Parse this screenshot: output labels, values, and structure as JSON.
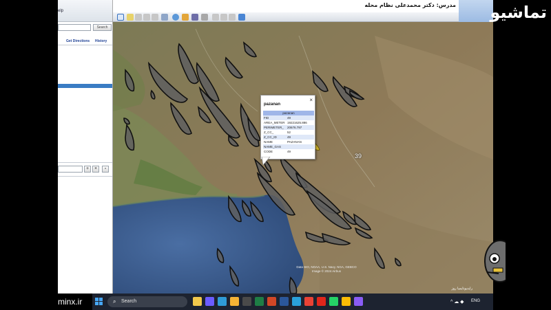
{
  "app": {
    "menu_help": "elp",
    "search": {
      "placeholder": "",
      "button_label": "Search"
    },
    "tabs": {
      "directions": "Get Directions",
      "history": "History"
    },
    "list_controls": {
      "add": "+",
      "remove": "×"
    }
  },
  "header": {
    "instructor": "مدرس: دکتر محمدعلی نظام محله",
    "logo_text": "تماشیو"
  },
  "popup": {
    "title": "pazanan",
    "close": "×",
    "table_header": "pazanan",
    "rows": [
      {
        "key": "FID",
        "value": "49"
      },
      {
        "key": "AREA_METER",
        "value": "19221625.886"
      },
      {
        "key": "PERIMETER_",
        "value": "20676.797"
      },
      {
        "key": "Z_CC_",
        "value": "52"
      },
      {
        "key": "Z_CC_ID",
        "value": "49"
      },
      {
        "key": "NAME",
        "value": "PAZANAN"
      },
      {
        "key": "NAME_GAS",
        "value": ""
      },
      {
        "key": "CODE",
        "value": "49"
      }
    ]
  },
  "map": {
    "label_39": "39",
    "attribution_line1": "Data SIO, NOAA, U.S. Navy, NGA, GEBCO",
    "attribution_line2": "Image © 2024 Airbus",
    "status": "ﺭﺍﻳﺪﻳﻮﻧﺎﻳﻤﻴﺎ ﺭﻭﺯ"
  },
  "watermark": {
    "site": "minx.ir"
  },
  "taskbar": {
    "search_label": "Search",
    "language": "ENG",
    "apps": [
      "file-explorer",
      "copilot",
      "edge",
      "folder",
      "calculator",
      "excel",
      "powerpoint",
      "word",
      "telegram",
      "chrome",
      "opera",
      "whatsapp",
      "chrome-alt",
      "media"
    ],
    "app_colors": [
      "#f2c94c",
      "#6b5cff",
      "#2f9bd6",
      "#f5b335",
      "#4a4a4a",
      "#1e7e45",
      "#d24726",
      "#2b579a",
      "#2aa1da",
      "#e94235",
      "#e0261b",
      "#25d366",
      "#fbbc05",
      "#8a5cf5"
    ]
  },
  "colors": {
    "polygon_fill": "#5f5f5f",
    "polygon_stroke": "#111111",
    "water": "#3d5f92",
    "selected_row": "#3a7cc4",
    "popup_header": "#9fb6e8"
  }
}
